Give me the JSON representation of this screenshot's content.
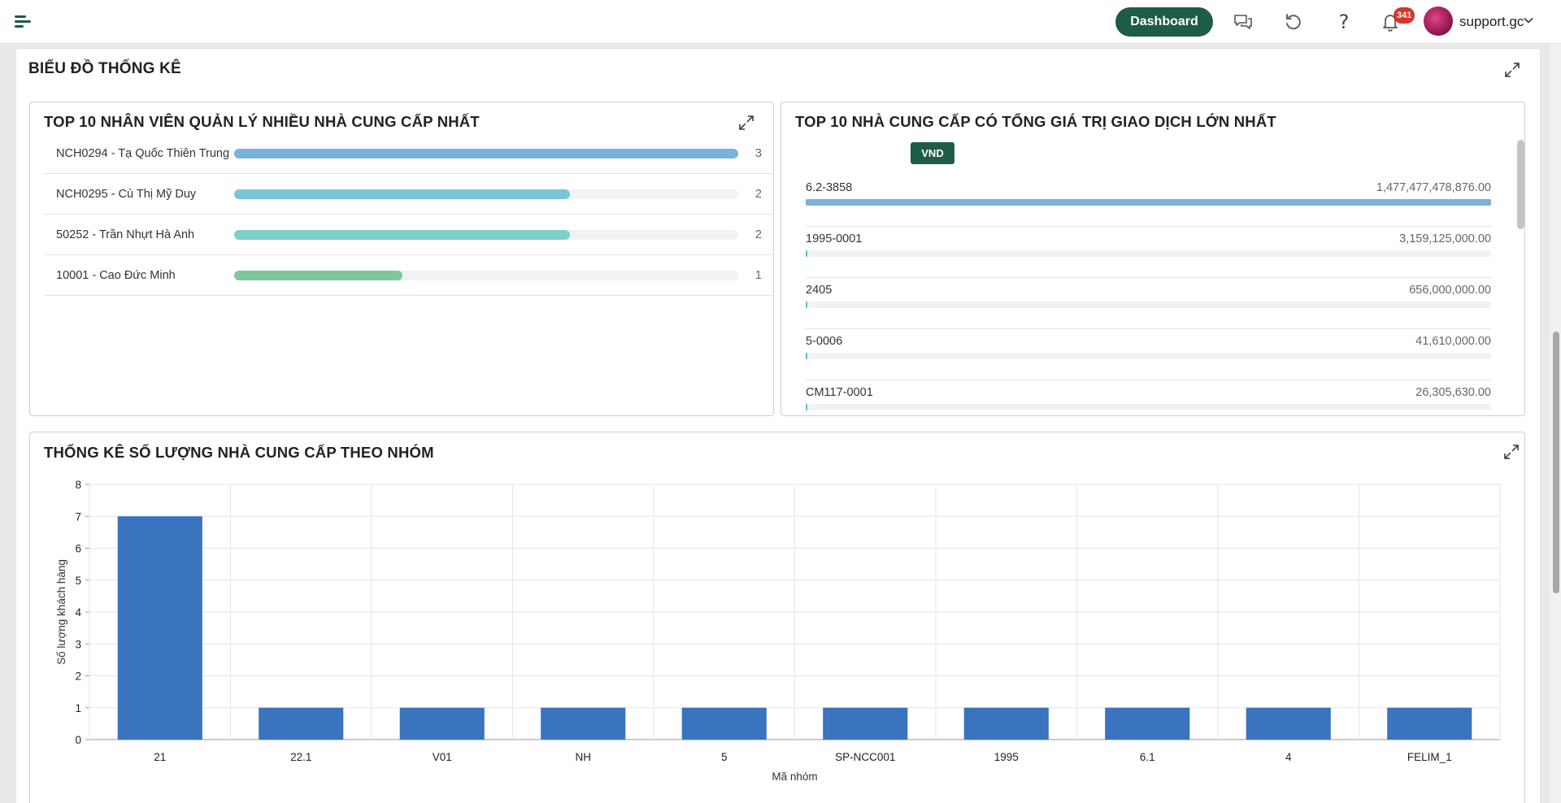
{
  "header": {
    "dashboard_label": "Dashboard",
    "notification_count": "341",
    "username": "support.gc",
    "icons": [
      "menu-icon",
      "chat-icon",
      "refresh-icon",
      "help-icon",
      "bell-icon",
      "chevron-down-icon"
    ],
    "help_glyph": "?",
    "accent_color": "#1f5c45",
    "badge_color": "#d9332b"
  },
  "page": {
    "title": "BIỂU ĐỒ THỐNG KÊ"
  },
  "employees_card": {
    "title": "TOP 10 NHÂN VIÊN QUẢN LÝ NHIỀU NHÀ CUNG CẤP NHẤT",
    "max": 3,
    "items": [
      {
        "label": "NCH0294 - Tạ Quốc Thiên Trung",
        "value": 3,
        "color": "#7ab2de"
      },
      {
        "label": "NCH0295 - Cù Thị Mỹ Duy",
        "value": 2,
        "color": "#78c6d8"
      },
      {
        "label": "50252 - Trần Nhựt Hà Anh",
        "value": 2,
        "color": "#7dd0c7"
      },
      {
        "label": "10001 - Cao Đức Minh",
        "value": 1,
        "color": "#7ec79c"
      }
    ]
  },
  "suppliers_card": {
    "title": "TOP 10 NHÀ CUNG CẤP CÓ TỔNG GIÁ TRỊ GIAO DỊCH LỚN NHẤT",
    "currency": "VND",
    "items": [
      {
        "label": "6.2-3858",
        "value_text": "1,477,477,478,876.00",
        "value": 1477477478876
      },
      {
        "label": "1995-0001",
        "value_text": "3,159,125,000.00",
        "value": 3159125000
      },
      {
        "label": "2405",
        "value_text": "656,000,000.00",
        "value": 656000000
      },
      {
        "label": "5-0006",
        "value_text": "41,610,000.00",
        "value": 41610000
      },
      {
        "label": "CM117-0001",
        "value_text": "26,305,630.00",
        "value": 26305630
      }
    ]
  },
  "group_card": {
    "title": "THỐNG KÊ SỐ LƯỢNG NHÀ CUNG CẤP THEO NHÓM"
  },
  "chart_data": {
    "type": "bar",
    "title": "THỐNG KÊ SỐ LƯỢNG NHÀ CUNG CẤP THEO NHÓM",
    "categories": [
      "21",
      "22.1",
      "V01",
      "NH",
      "5",
      "SP-NCC001",
      "1995",
      "6.1",
      "4",
      "FELIM_1"
    ],
    "values": [
      7,
      1,
      1,
      1,
      1,
      1,
      1,
      1,
      1,
      1
    ],
    "xlabel": "Mã nhóm",
    "ylabel": "Số lượng khách hàng",
    "ylim": [
      0,
      8
    ],
    "yticks": [
      "0",
      "1",
      "2",
      "3",
      "4",
      "5",
      "6",
      "7",
      "8"
    ],
    "grid": true,
    "bar_color": "#3a73be"
  }
}
